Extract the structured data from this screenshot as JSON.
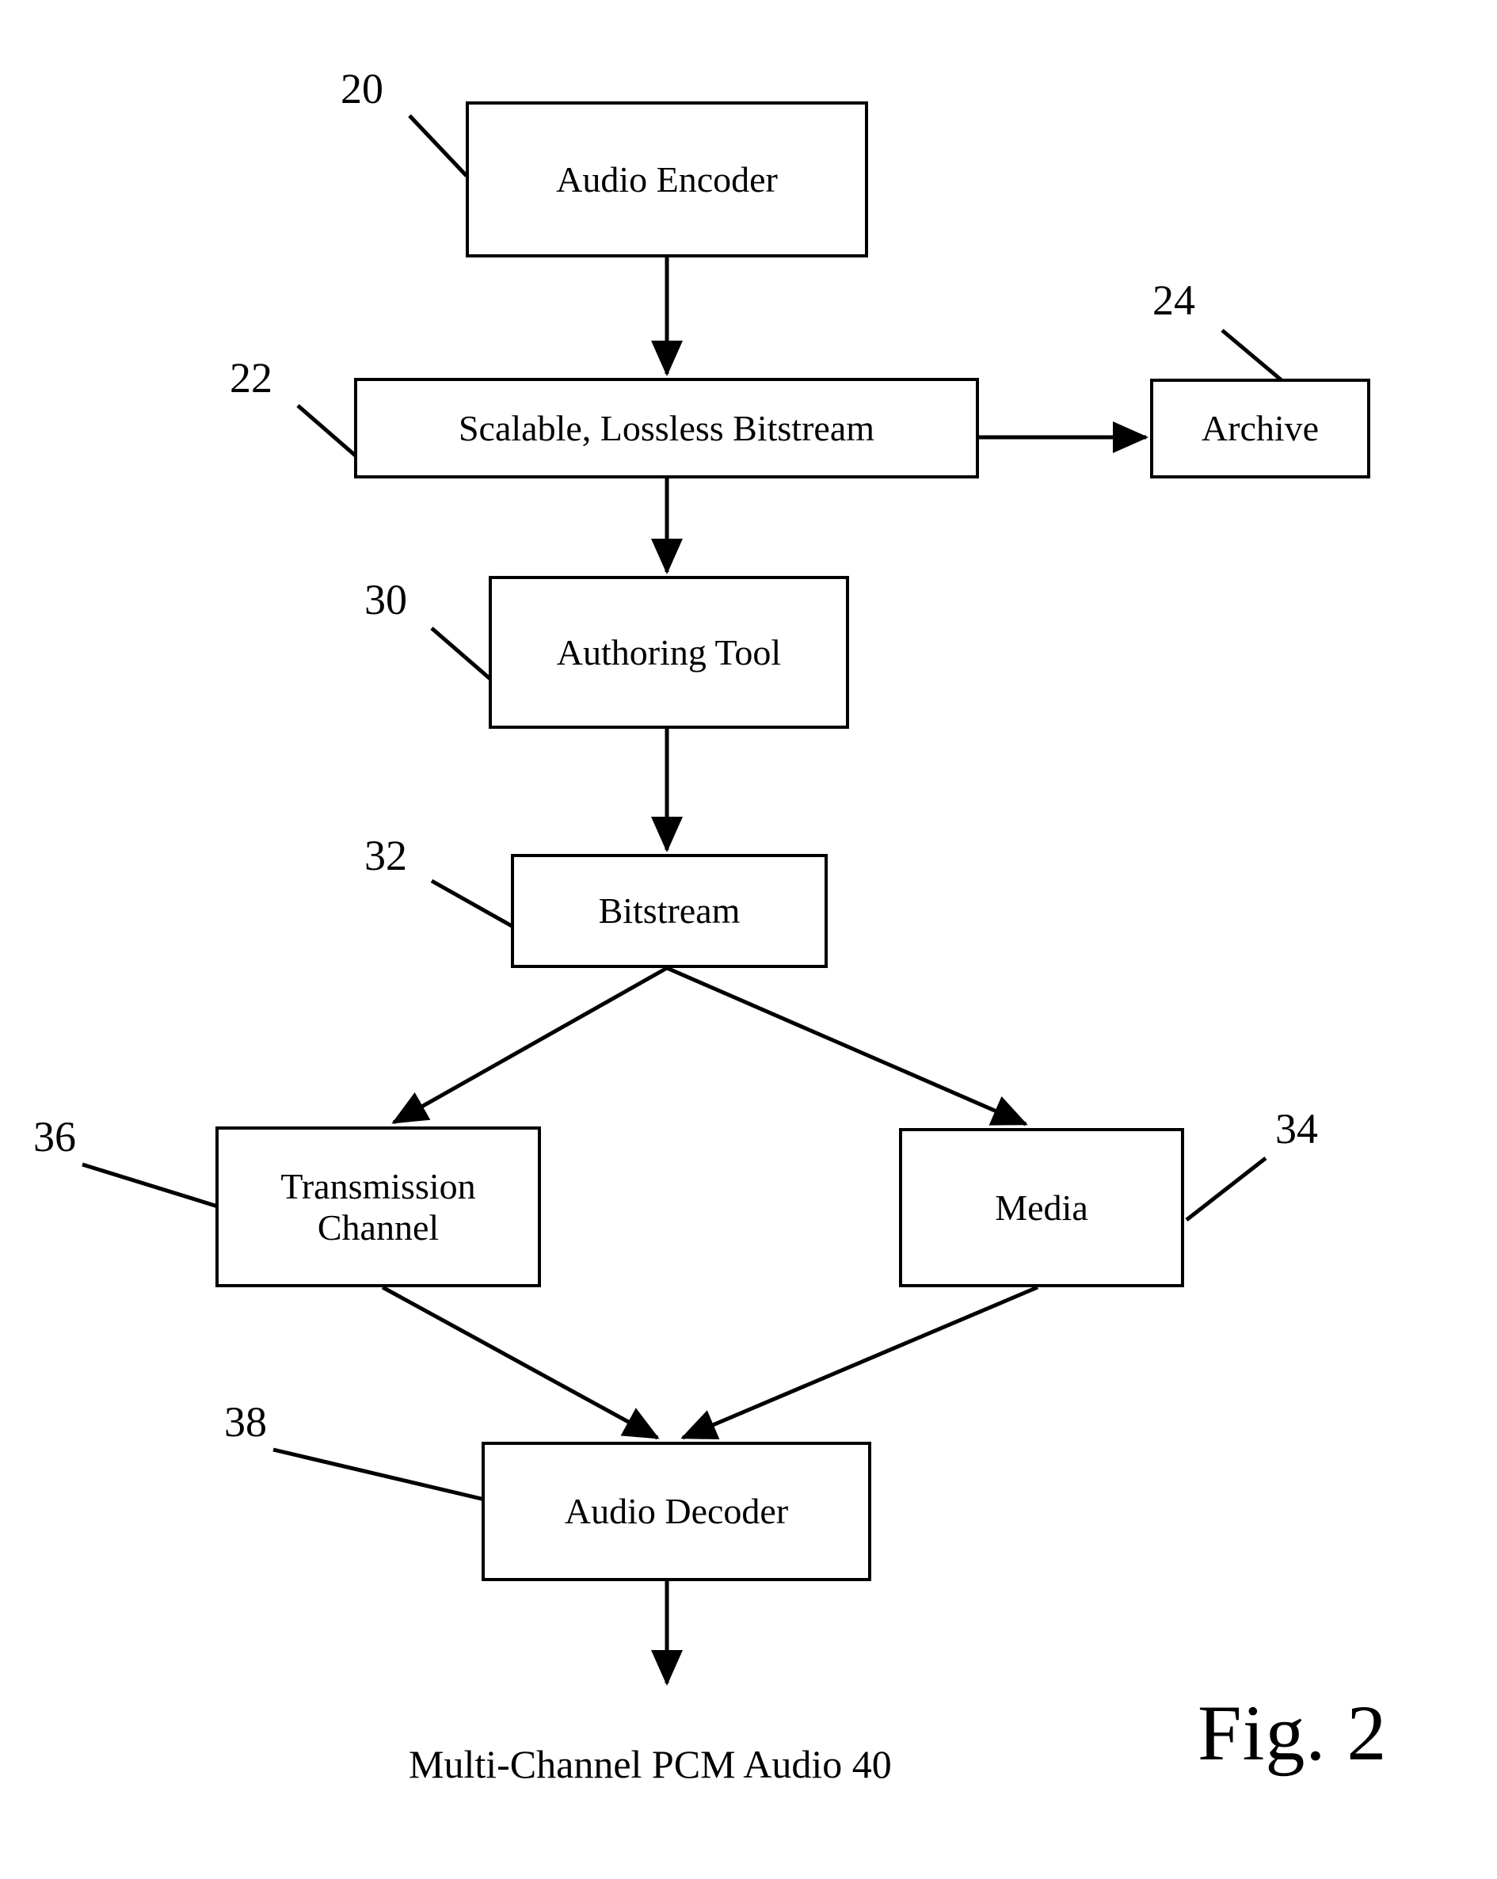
{
  "figure": {
    "title": "Fig. 2",
    "caption": "Multi-Channel PCM Audio 40"
  },
  "nodes": [
    {
      "id": "audio-encoder",
      "label": "Audio Encoder",
      "ref": "20"
    },
    {
      "id": "scalable-bitstream",
      "label": "Scalable, Lossless Bitstream",
      "ref": "22"
    },
    {
      "id": "archive",
      "label": "Archive",
      "ref": "24"
    },
    {
      "id": "authoring-tool",
      "label": "Authoring Tool",
      "ref": "30"
    },
    {
      "id": "bitstream",
      "label": "Bitstream",
      "ref": "32"
    },
    {
      "id": "media",
      "label": "Media",
      "ref": "34"
    },
    {
      "id": "transmission-channel",
      "label": "Transmission\nChannel",
      "ref": "36"
    },
    {
      "id": "audio-decoder",
      "label": "Audio Decoder",
      "ref": "38"
    }
  ],
  "refs": {
    "n20": "20",
    "n22": "22",
    "n24": "24",
    "n30": "30",
    "n32": "32",
    "n34": "34",
    "n36": "36",
    "n38": "38"
  },
  "labels": {
    "audio_encoder": "Audio Encoder",
    "scalable_bitstream": "Scalable, Lossless Bitstream",
    "archive": "Archive",
    "authoring_tool": "Authoring Tool",
    "bitstream": "Bitstream",
    "media": "Media",
    "transmission_channel": "Transmission\nChannel",
    "audio_decoder": "Audio Decoder"
  },
  "flow": [
    {
      "from": "audio-encoder",
      "to": "scalable-bitstream",
      "direction": "down"
    },
    {
      "from": "scalable-bitstream",
      "to": "archive",
      "direction": "right"
    },
    {
      "from": "scalable-bitstream",
      "to": "authoring-tool",
      "direction": "down"
    },
    {
      "from": "authoring-tool",
      "to": "bitstream",
      "direction": "down"
    },
    {
      "from": "bitstream",
      "to": "transmission-channel",
      "direction": "down-left"
    },
    {
      "from": "bitstream",
      "to": "media",
      "direction": "down-right"
    },
    {
      "from": "transmission-channel",
      "to": "audio-decoder",
      "direction": "down-right"
    },
    {
      "from": "media",
      "to": "audio-decoder",
      "direction": "down-left"
    },
    {
      "from": "audio-decoder",
      "to": "multi-channel-output",
      "direction": "down"
    }
  ],
  "colors": {
    "stroke": "#000000",
    "background": "#ffffff",
    "text": "#000000"
  }
}
